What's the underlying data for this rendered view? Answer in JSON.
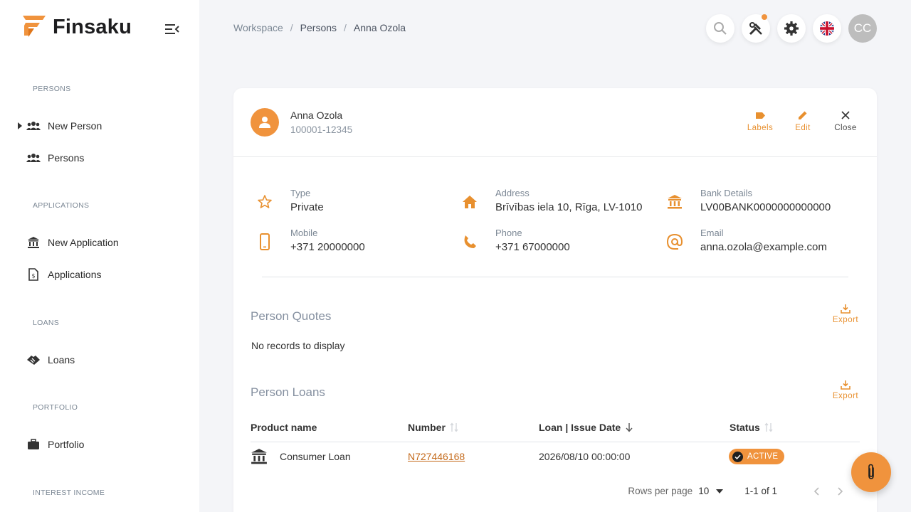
{
  "app": {
    "name": "Finsaku"
  },
  "colors": {
    "accent": "#f0933d",
    "link": "#c46a1b"
  },
  "sidebar": {
    "sections": [
      {
        "label": "PERSONS",
        "items": [
          {
            "label": "New Person",
            "icon": "people-icon",
            "expandable": true
          },
          {
            "label": "Persons",
            "icon": "people-icon"
          }
        ]
      },
      {
        "label": "APPLICATIONS",
        "items": [
          {
            "label": "New Application",
            "icon": "bank-icon"
          },
          {
            "label": "Applications",
            "icon": "document-icon"
          }
        ]
      },
      {
        "label": "LOANS",
        "items": [
          {
            "label": "Loans",
            "icon": "handshake-icon"
          }
        ]
      },
      {
        "label": "PORTFOLIO",
        "items": [
          {
            "label": "Portfolio",
            "icon": "briefcase-icon"
          }
        ]
      },
      {
        "label": "INTEREST INCOME",
        "items": []
      }
    ]
  },
  "breadcrumb": {
    "workspace": "Workspace",
    "persons": "Persons",
    "current": "Anna Ozola",
    "separator": "/"
  },
  "topbar": {
    "avatar_initials": "CC"
  },
  "person": {
    "name": "Anna Ozola",
    "id": "100001-12345",
    "actions": {
      "labels": "Labels",
      "edit": "Edit",
      "close": "Close"
    },
    "details": {
      "type": {
        "label": "Type",
        "value": "Private"
      },
      "address": {
        "label": "Address",
        "value": "Brīvības iela 10, Rīga, LV-1010"
      },
      "bank": {
        "label": "Bank Details",
        "value": "LV00BANK0000000000000"
      },
      "mobile": {
        "label": "Mobile",
        "value": "+371 20000000"
      },
      "phone": {
        "label": "Phone",
        "value": "+371 67000000"
      },
      "email": {
        "label": "Email",
        "value": "anna.ozola@example.com"
      }
    }
  },
  "quotes": {
    "title": "Person Quotes",
    "export": "Export",
    "empty": "No records to display"
  },
  "loans": {
    "title": "Person Loans",
    "export": "Export",
    "columns": {
      "product": "Product name",
      "number": "Number",
      "date": "Loan | Issue Date",
      "status": "Status"
    },
    "rows": [
      {
        "product": "Consumer Loan",
        "number": "N727446168",
        "date": "2026/08/10 00:00:00",
        "status": "ACTIVE"
      }
    ],
    "pager": {
      "rows_per_page_label": "Rows per page",
      "rows_per_page": "10",
      "range": "1-1 of 1"
    }
  }
}
